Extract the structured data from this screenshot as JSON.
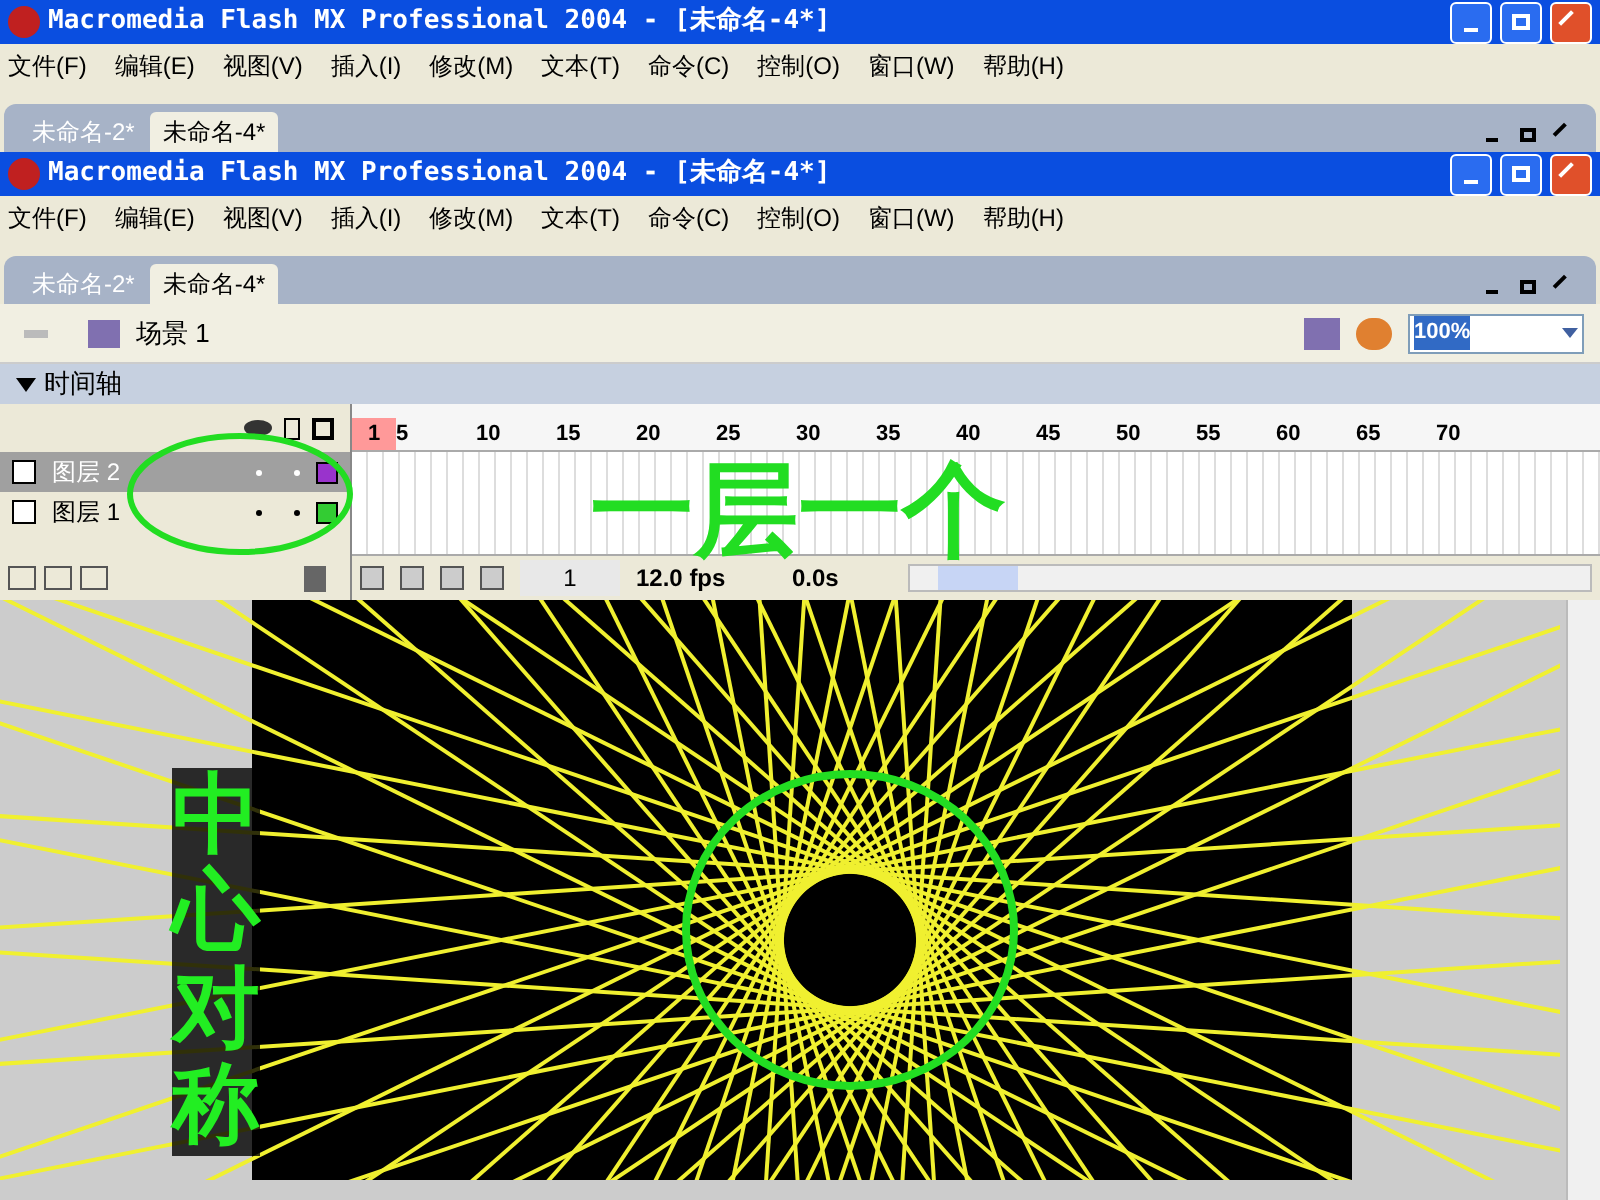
{
  "outer_window": {
    "title": "Macromedia Flash MX Professional 2004 - [未命名-4*]",
    "menu": [
      "文件(F)",
      "编辑(E)",
      "视图(V)",
      "插入(I)",
      "修改(M)",
      "文本(T)",
      "命令(C)",
      "控制(O)",
      "窗口(W)",
      "帮助(H)"
    ],
    "tabs": [
      {
        "label": "未命名-2*",
        "selected": false
      },
      {
        "label": "未命名-4*",
        "selected": true
      }
    ]
  },
  "inner_window": {
    "title": "Macromedia Flash MX Professional 2004 - [未命名-4*]",
    "menu": [
      "文件(F)",
      "编辑(E)",
      "视图(V)",
      "插入(I)",
      "修改(M)",
      "文本(T)",
      "命令(C)",
      "控制(O)",
      "窗口(W)",
      "帮助(H)"
    ],
    "tabs": [
      {
        "label": "未命名-2*",
        "selected": false
      },
      {
        "label": "未命名-4*",
        "selected": true
      }
    ]
  },
  "scene": {
    "label": "场景 1",
    "zoom": "100%"
  },
  "timeline": {
    "title": "时间轴",
    "ruler": [
      "1",
      "5",
      "10",
      "15",
      "20",
      "25",
      "30",
      "35",
      "40",
      "45",
      "50",
      "55",
      "60",
      "65",
      "70"
    ],
    "layers": [
      {
        "name": "图层 2",
        "selected": true,
        "color": "#9933cc"
      },
      {
        "name": "图层 1",
        "selected": false,
        "color": "#33cc33"
      }
    ],
    "frame": "1",
    "fps": "12.0 fps",
    "time": "0.0s"
  },
  "annotations": [
    {
      "text": "一层一个"
    },
    {
      "text": "中心对称"
    }
  ]
}
